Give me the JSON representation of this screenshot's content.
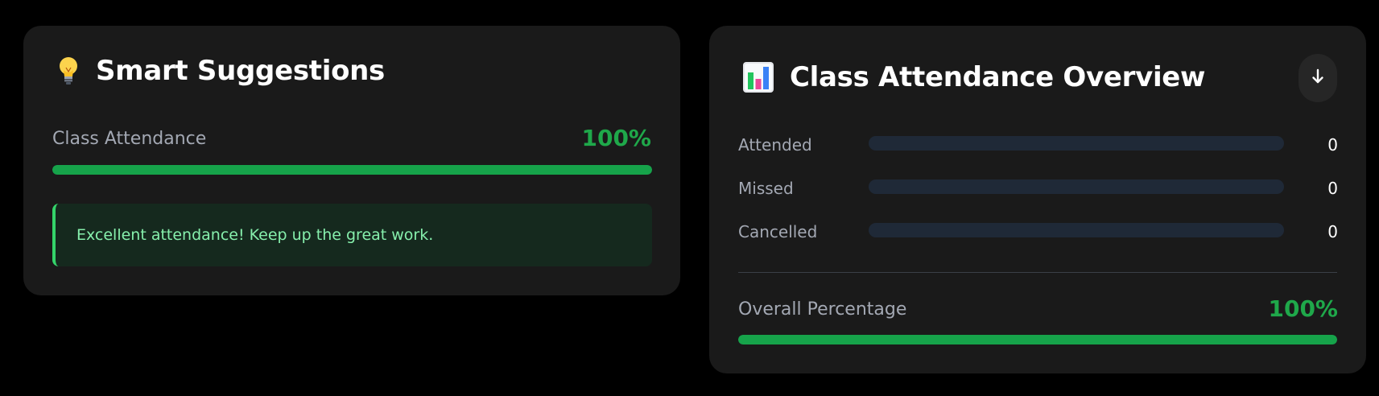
{
  "smart_suggestions": {
    "title": "Smart Suggestions",
    "icon": "lightbulb-icon",
    "class_attendance_label": "Class Attendance",
    "class_attendance_percent_text": "100%",
    "class_attendance_fraction": 1.0,
    "suggestion_message": "Excellent attendance! Keep up the great work."
  },
  "overview": {
    "title": "Class Attendance Overview",
    "icon": "bar-chart-icon",
    "download_button_icon": "arrow-down-icon",
    "rows": [
      {
        "label": "Attended",
        "value": "0",
        "fraction": 0
      },
      {
        "label": "Missed",
        "value": "0",
        "fraction": 0
      },
      {
        "label": "Cancelled",
        "value": "0",
        "fraction": 0
      }
    ],
    "overall_label": "Overall Percentage",
    "overall_percent_text": "100%",
    "overall_fraction": 1.0
  },
  "colors": {
    "background": "#000000",
    "card": "#1a1a1a",
    "accent_green": "#16a34a",
    "track": "#1f2937",
    "suggestion_bg": "#15291e",
    "suggestion_text": "#86efac"
  }
}
